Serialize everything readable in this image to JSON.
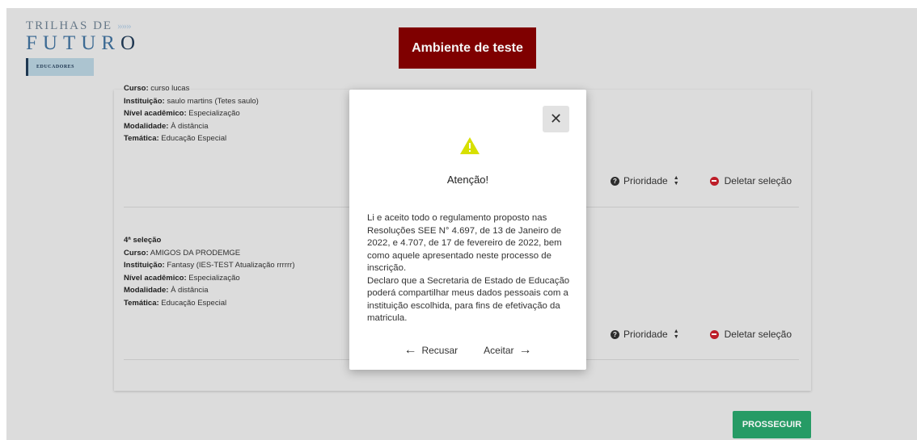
{
  "logo": {
    "line1": "TRILHAS DE",
    "arrows": "»»»",
    "line2_main": "FUTUR",
    "line2_last": "O",
    "badge": "EDUCADORES"
  },
  "env_banner": "Ambiente de teste",
  "selections": [
    {
      "heading": "",
      "fields": [
        {
          "label": "Curso:",
          "value": "curso lucas"
        },
        {
          "label": "Instituição:",
          "value": "saulo martins (Tetes saulo)"
        },
        {
          "label": "Nível acadêmico:",
          "value": "Especialização"
        },
        {
          "label": "Modalidade:",
          "value": "À distância"
        },
        {
          "label": "Temática:",
          "value": "Educação Especial"
        }
      ],
      "priority_label": "Prioridade",
      "delete_label": "Deletar seleção"
    },
    {
      "heading": "4ª seleção",
      "fields": [
        {
          "label": "Curso:",
          "value": "AMIGOS DA PRODEMGE"
        },
        {
          "label": "Instituição:",
          "value": "Fantasy (IES-TEST Atualização rrrrrr)"
        },
        {
          "label": "Nível acadêmico:",
          "value": "Especialização"
        },
        {
          "label": "Modalidade:",
          "value": "À distância"
        },
        {
          "label": "Temática:",
          "value": "Educação Especial"
        }
      ],
      "priority_label": "Prioridade",
      "delete_label": "Deletar seleção"
    }
  ],
  "proceed_button": "PROSSEGUIR",
  "modal": {
    "close_glyph": "✕",
    "title": "Atenção!",
    "paragraph1": "Li e aceito todo o regulamento proposto nas Resoluções SEE N° 4.697, de 13 de Janeiro de 2022, e 4.707, de 17 de fevereiro de 2022, bem como aquele apresentado neste processo de inscrição.",
    "paragraph2": "Declaro que a Secretaria de Estado de Educação poderá compartilhar meus dados pessoais com a instituição escolhida, para fins de efetivação da matricula.",
    "reject_label": "Recusar",
    "accept_label": "Aceitar"
  },
  "colors": {
    "page_bg": "#e5e5e5",
    "env_banner": "#850000",
    "proceed": "#28a26a",
    "delete_icon": "#c51f2a",
    "warning": "#d7e000"
  },
  "icons": [
    "warning-triangle-icon",
    "close-icon",
    "question-circle-icon",
    "sort-icon",
    "minus-circle-icon",
    "arrow-left-icon",
    "arrow-right-icon"
  ]
}
